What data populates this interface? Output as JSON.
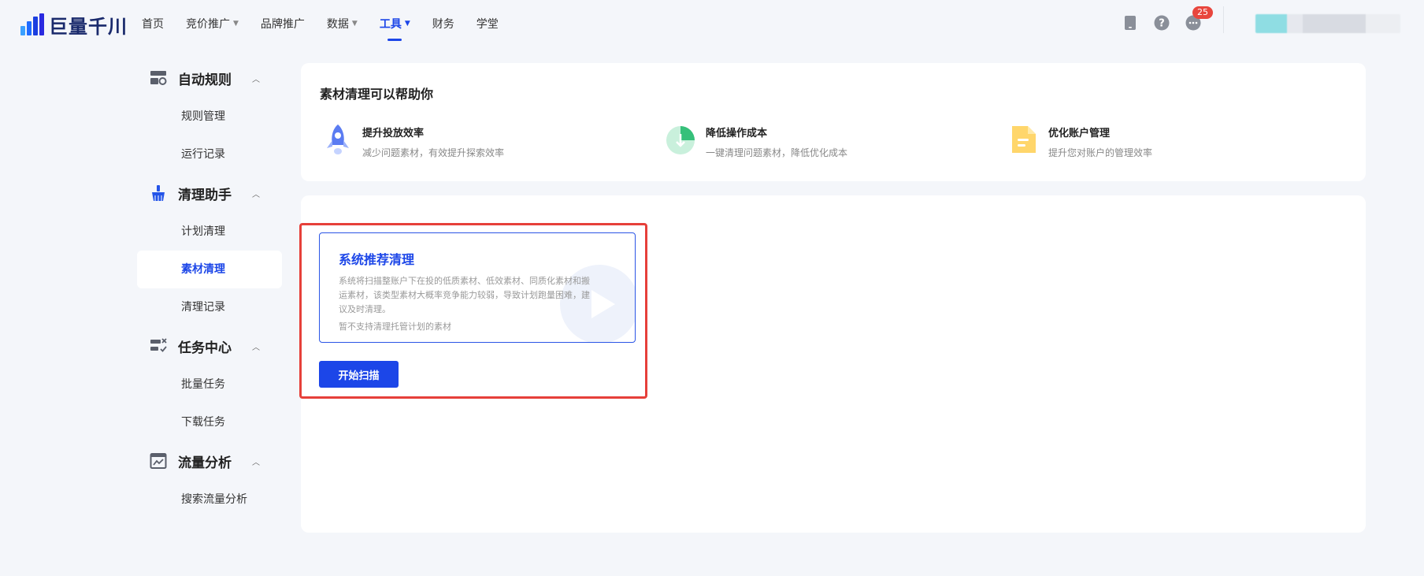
{
  "brand": {
    "name": "巨量千川"
  },
  "nav": {
    "items": [
      {
        "label": "首页",
        "dropdown": false,
        "active": false
      },
      {
        "label": "竞价推广",
        "dropdown": true,
        "active": false
      },
      {
        "label": "品牌推广",
        "dropdown": false,
        "active": false
      },
      {
        "label": "数据",
        "dropdown": true,
        "active": false
      },
      {
        "label": "工具",
        "dropdown": true,
        "active": true
      },
      {
        "label": "财务",
        "dropdown": false,
        "active": false
      },
      {
        "label": "学堂",
        "dropdown": false,
        "active": false
      }
    ]
  },
  "header_icons": {
    "phone": "phone-icon",
    "help": "help-icon",
    "messages": "message-icon",
    "message_count": "25"
  },
  "sidebar": {
    "groups": [
      {
        "title": "自动规则",
        "icon": "auto-rule-icon",
        "items": [
          "规则管理",
          "运行记录"
        ]
      },
      {
        "title": "清理助手",
        "icon": "broom-icon",
        "items": [
          "计划清理",
          "素材清理",
          "清理记录"
        ]
      },
      {
        "title": "任务中心",
        "icon": "task-center-icon",
        "items": [
          "批量任务",
          "下载任务"
        ]
      },
      {
        "title": "流量分析",
        "icon": "traffic-analysis-icon",
        "items": [
          "搜索流量分析"
        ]
      }
    ],
    "active_item": "素材清理"
  },
  "help_card": {
    "title": "素材清理可以帮助你",
    "features": [
      {
        "title": "提升投放效率",
        "desc": "减少问题素材，有效提升探索效率",
        "icon": "rocket-icon"
      },
      {
        "title": "降低操作成本",
        "desc": "一键清理问题素材，降低优化成本",
        "icon": "cost-down-icon"
      },
      {
        "title": "优化账户管理",
        "desc": "提升您对账户的管理效率",
        "icon": "folder-icon"
      }
    ]
  },
  "recommend": {
    "title": "系统推荐清理",
    "desc": "系统将扫描整账户下在投的低质素材、低效素材、同质化素材和搬运素材，该类型素材大概率竞争能力较弱，导致计划跑量困难，建议及时清理。",
    "note": "暂不支持清理托管计划的素材",
    "button": "开始扫描"
  },
  "colors": {
    "accent": "#1c46e8",
    "highlight_frame": "#e6403a",
    "badge": "#e8463d"
  }
}
